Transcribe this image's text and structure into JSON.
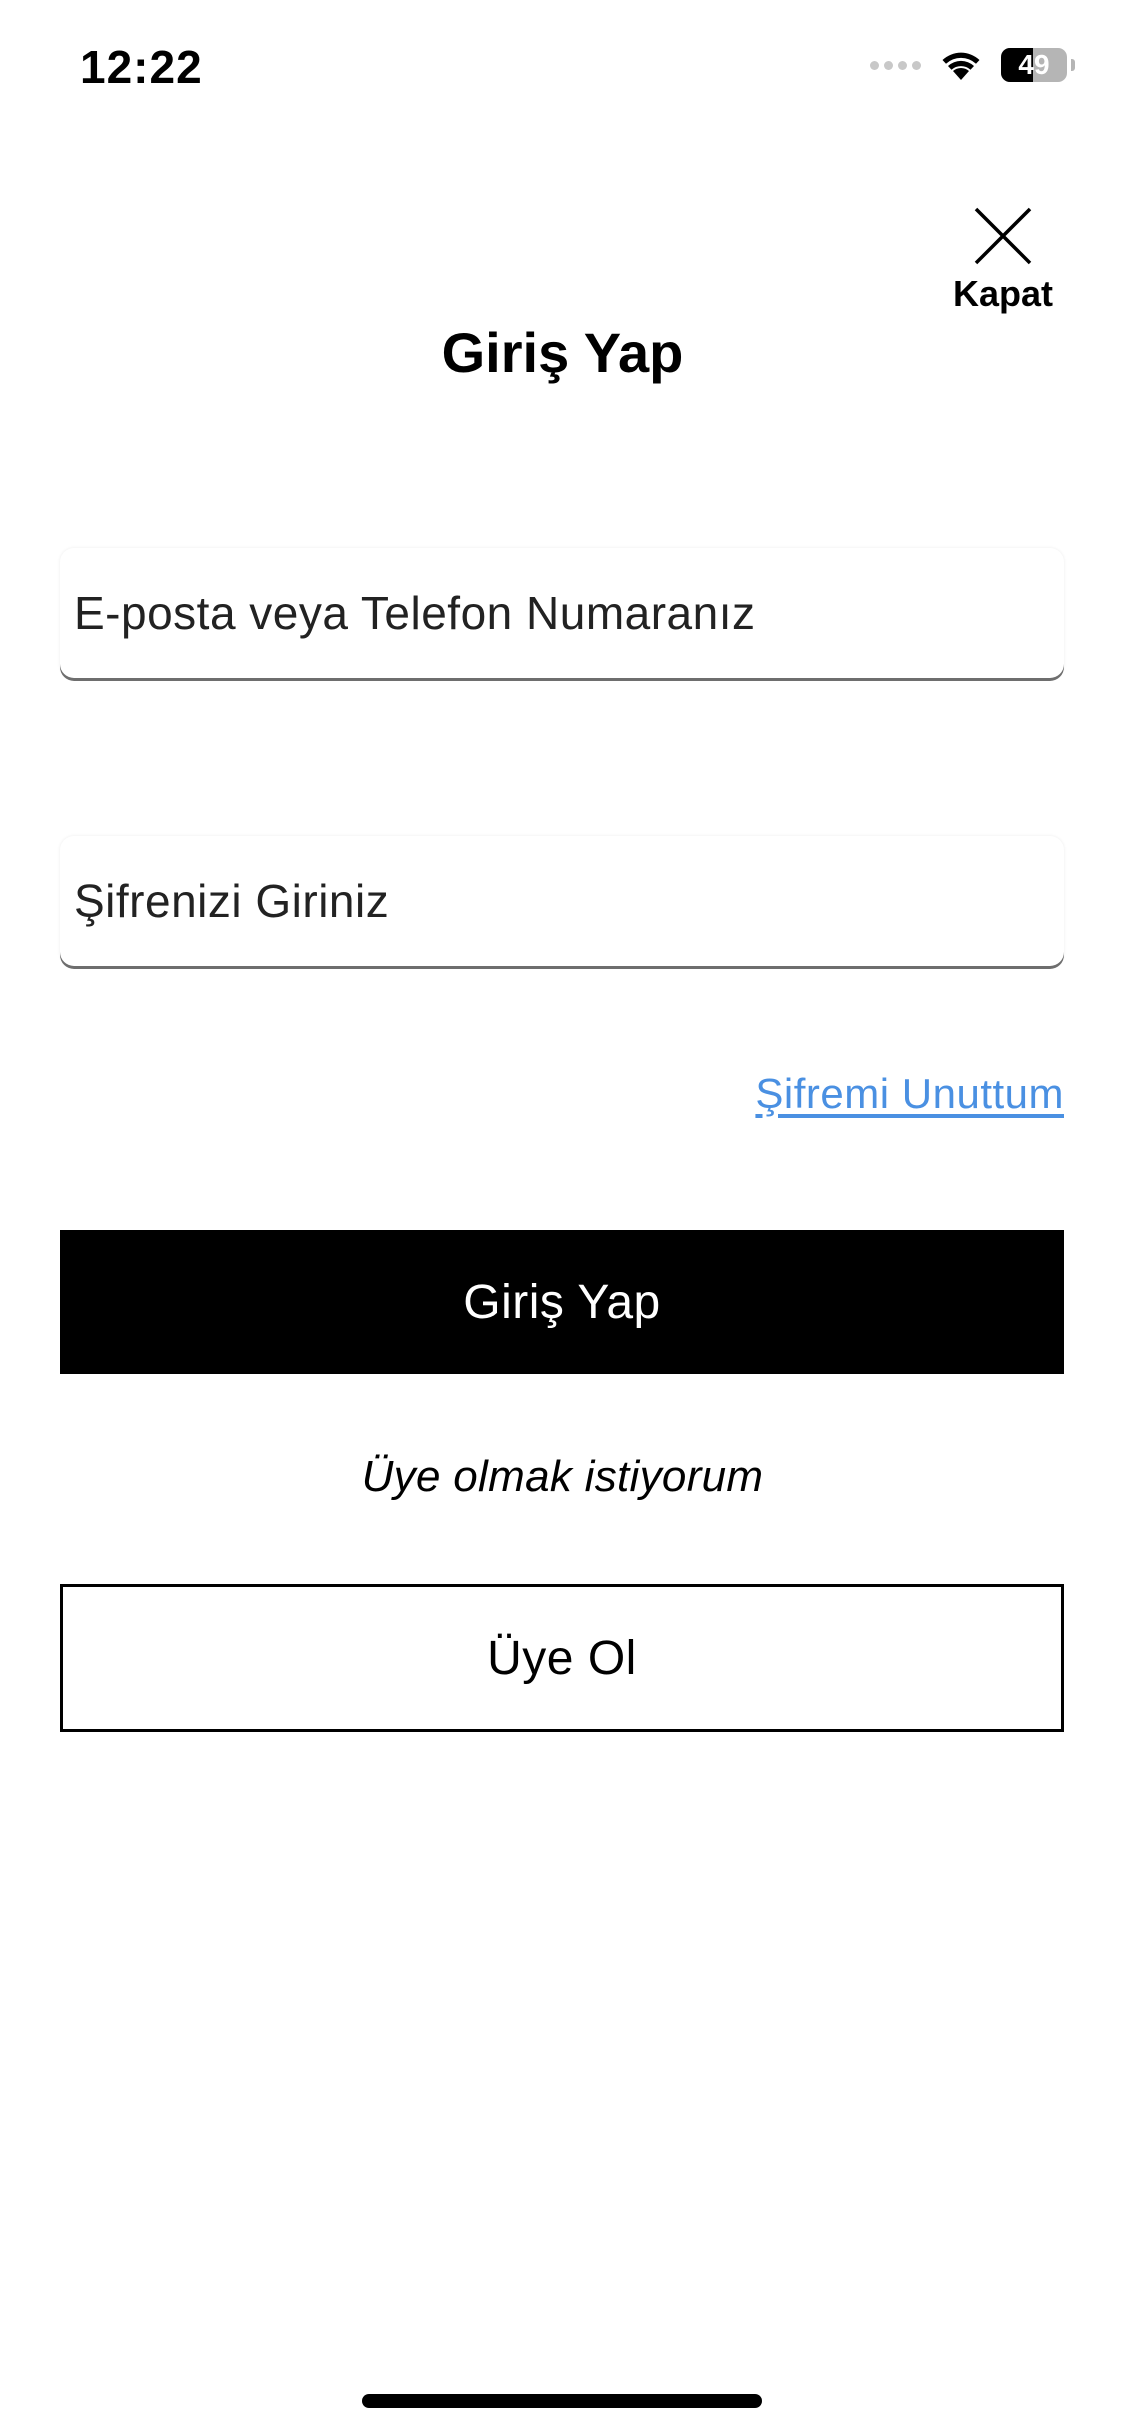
{
  "status_bar": {
    "time": "12:22",
    "battery_level": "49",
    "battery_fraction": 0.49,
    "signal_icon": "cellular-signal-icon",
    "wifi_icon": "wifi-icon"
  },
  "header": {
    "title": "Giriş Yap",
    "close_label": "Kapat",
    "close_icon": "close-icon"
  },
  "form": {
    "email_placeholder": "E-posta veya Telefon Numaranız",
    "email_value": "",
    "password_placeholder": "Şifrenizi Giriniz",
    "password_value": "",
    "forgot_password_label": "Şifremi Unuttum",
    "login_button_label": "Giriş Yap"
  },
  "signup": {
    "prompt": "Üye olmak istiyorum",
    "button_label": "Üye Ol"
  },
  "colors": {
    "link": "#4a90e2",
    "primary_button_bg": "#000000",
    "primary_button_text": "#ffffff"
  }
}
